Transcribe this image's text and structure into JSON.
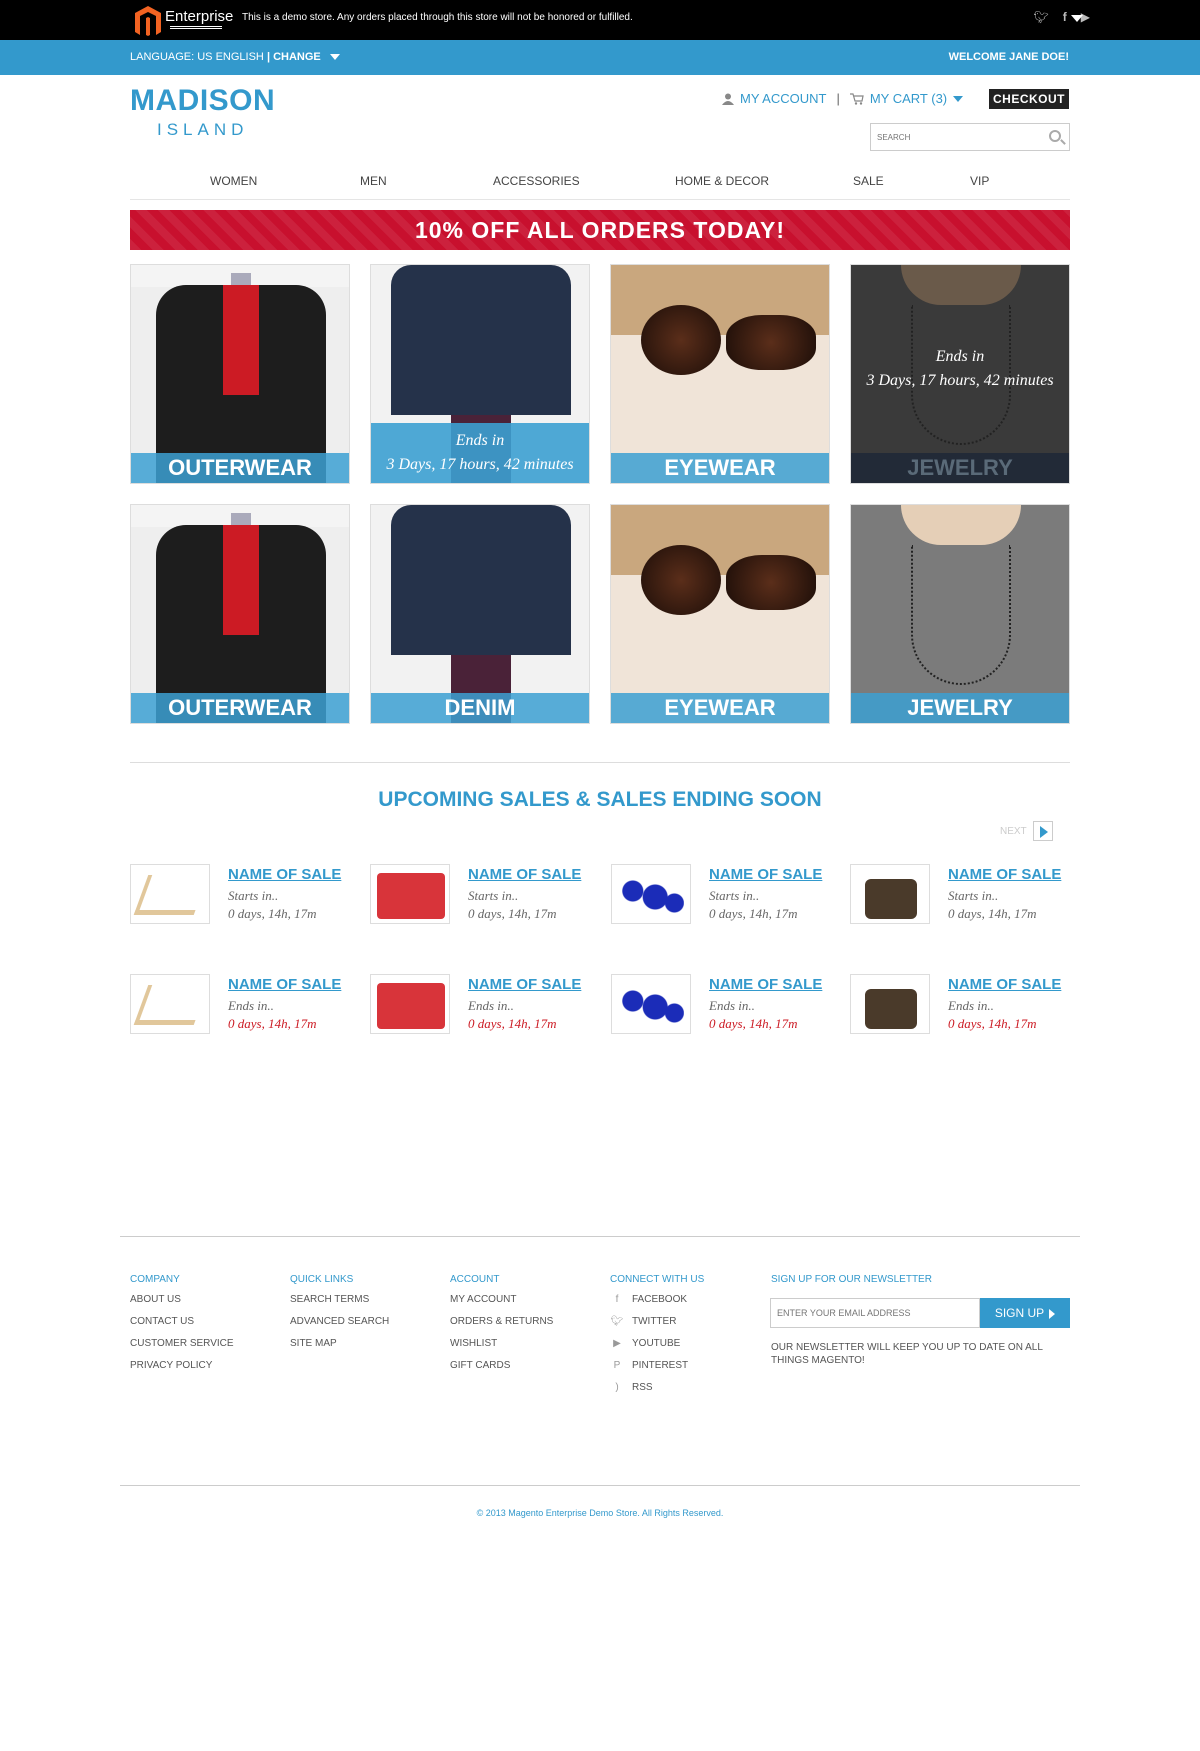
{
  "topbar": {
    "logo_text": "Enterprise",
    "logo_sub": "EDITION",
    "notice": "This is a demo store. Any orders placed through this store will not be honored or fulfilled.",
    "social_icons": [
      "twitter-icon",
      "facebook-icon",
      "youtube-icon"
    ]
  },
  "bluebar": {
    "language_label": "LANGUAGE: US ENGLISH",
    "change_label": "| CHANGE",
    "welcome": "WELCOME JANE DOE!"
  },
  "header": {
    "brand_line1": "MADISON",
    "brand_line2": "ISLAND",
    "my_account": "MY ACCOUNT",
    "my_cart": "MY CART (3)",
    "checkout": "CHECKOUT",
    "search_placeholder": "SEARCH"
  },
  "nav": [
    "WOMEN",
    "MEN",
    "ACCESSORIES",
    "HOME & DECOR",
    "SALE",
    "VIP"
  ],
  "promo": "10% OFF ALL ORDERS TODAY!",
  "tiles": [
    {
      "label": "OUTERWEAR",
      "countdown_1": "",
      "countdown_2": ""
    },
    {
      "label": "",
      "countdown_1": "Ends in",
      "countdown_2": "3 Days, 17 hours, 42 minutes"
    },
    {
      "label": "EYEWEAR",
      "countdown_1": "",
      "countdown_2": ""
    },
    {
      "label": "JEWELRY",
      "countdown_1": "Ends in",
      "countdown_2": "3 Days, 17 hours, 42 minutes"
    },
    {
      "label": "OUTERWEAR"
    },
    {
      "label": "DENIM"
    },
    {
      "label": "EYEWEAR"
    },
    {
      "label": "JEWELRY"
    }
  ],
  "section": {
    "title": "UPCOMING SALES & SALES ENDING SOON",
    "next": "NEXT"
  },
  "sales": [
    {
      "name": "NAME OF SALE",
      "when": "Starts in..",
      "time": "0 days, 14h, 17m"
    },
    {
      "name": "NAME OF SALE",
      "when": "Starts in..",
      "time": "0 days, 14h, 17m"
    },
    {
      "name": "NAME OF SALE",
      "when": "Starts in..",
      "time": "0 days, 14h, 17m"
    },
    {
      "name": "NAME OF SALE",
      "when": "Starts in..",
      "time": "0 days, 14h, 17m"
    },
    {
      "name": "NAME OF SALE",
      "when": "Ends in..",
      "time": "0 days, 14h, 17m"
    },
    {
      "name": "NAME OF SALE",
      "when": "Ends in..",
      "time": "0 days, 14h, 17m"
    },
    {
      "name": "NAME OF SALE",
      "when": "Ends in..",
      "time": "0 days, 14h, 17m"
    },
    {
      "name": "NAME OF SALE",
      "when": "Ends in..",
      "time": "0 days, 14h, 17m"
    }
  ],
  "footer": {
    "company": {
      "heading": "COMPANY",
      "links": [
        "ABOUT US",
        "CONTACT US",
        "CUSTOMER SERVICE",
        "PRIVACY POLICY"
      ]
    },
    "quick": {
      "heading": "QUICK LINKS",
      "links": [
        "SEARCH TERMS",
        "ADVANCED SEARCH",
        "SITE MAP"
      ]
    },
    "account": {
      "heading": "ACCOUNT",
      "links": [
        "MY ACCOUNT",
        "ORDERS & RETURNS",
        "WISHLIST",
        "GIFT CARDS"
      ]
    },
    "connect": {
      "heading": "CONNECT WITH US",
      "links": [
        "FACEBOOK",
        "TWITTER",
        "YOUTUBE",
        "PINTEREST",
        "RSS"
      ]
    },
    "newsletter": {
      "heading": "SIGN UP FOR OUR NEWSLETTER",
      "placeholder": "ENTER YOUR EMAIL ADDRESS",
      "button": "SIGN UP",
      "note": "OUR NEWSLETTER WILL KEEP YOU UP TO DATE ON ALL THINGS MAGENTO!"
    },
    "copyright": "© 2013 Magento Enterprise Demo Store. All Rights Reserved."
  },
  "colors": {
    "accent": "#3399cc",
    "promo": "#c8102e",
    "countdown_red": "#cc1b24"
  }
}
